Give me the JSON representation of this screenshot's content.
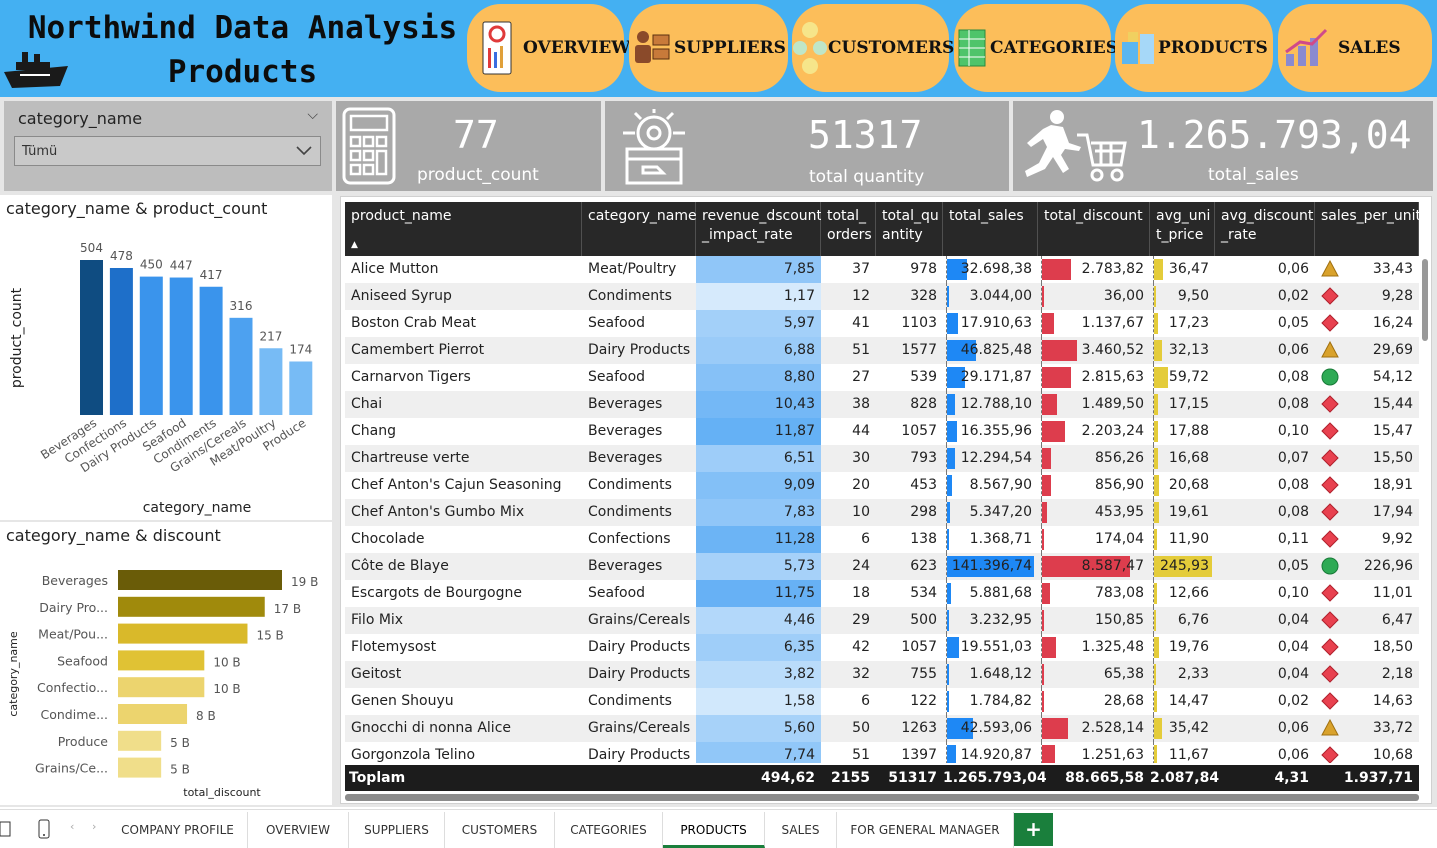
{
  "header": {
    "title_line1": "Northwind Data Analysis",
    "title_line2": "Products"
  },
  "nav": [
    {
      "label": "OVERVIEW",
      "icon": "overview-icon"
    },
    {
      "label": "SUPPLIERS",
      "icon": "suppliers-icon"
    },
    {
      "label": "CUSTOMERS",
      "icon": "customers-icon"
    },
    {
      "label": "CATEGORIES",
      "icon": "categories-icon"
    },
    {
      "label": "PRODUCTS",
      "icon": "products-icon"
    },
    {
      "label": "SALES",
      "icon": "sales-icon"
    }
  ],
  "slicer": {
    "title": "category_name",
    "value": "Tümü"
  },
  "kpis": [
    {
      "value": "77",
      "label": "product_count",
      "icon": "calculator-icon"
    },
    {
      "value": "51317",
      "label": "total quantity",
      "icon": "package-gear-icon"
    },
    {
      "value": "1.265.793,04",
      "label": "total_sales",
      "icon": "shopping-cart-runner-icon"
    }
  ],
  "colors": {
    "header_bg": "#44b0f2",
    "nav_bg": "#fcbe5a",
    "kpi_bg": "#a9a9a9",
    "bar_blue": "#1e88f5",
    "bar_red": "#dd3d4d",
    "bar_yellow": "#e4cc3a",
    "status_red": "#e8414f",
    "status_orange": "#d9a22c",
    "status_green": "#2eaa55"
  },
  "chart1": {
    "title": "category_name & product_count",
    "chart_data": {
      "type": "bar",
      "categories": [
        "Beverages",
        "Confections",
        "Dairy Products",
        "Seafood",
        "Condiments",
        "Grains/Cereals",
        "Meat/Poultry",
        "Produce"
      ],
      "values": [
        504,
        478,
        450,
        447,
        417,
        316,
        217,
        174
      ],
      "xlabel": "category_name",
      "ylabel": "product_count",
      "ylim": [
        0,
        560
      ],
      "colors": [
        "#0f4c81",
        "#1e6fc9",
        "#3a94ec",
        "#3a94ec",
        "#3a94ec",
        "#4da1f0",
        "#77bbf5",
        "#77bbf5"
      ]
    }
  },
  "chart2": {
    "title": "category_name & discount",
    "chart_data": {
      "type": "bar",
      "orientation": "horizontal",
      "categories": [
        "Beverages",
        "Dairy Pro...",
        "Meat/Pou...",
        "Seafood",
        "Confectio...",
        "Condime...",
        "Produce",
        "Grains/Ce..."
      ],
      "values": [
        19,
        17,
        15,
        10,
        10,
        8,
        5,
        5
      ],
      "value_labels": [
        "19 B",
        "17 B",
        "15 B",
        "10 B",
        "10 B",
        "8 B",
        "5 B",
        "5 B"
      ],
      "xlabel": "total_discount",
      "ylabel": "category_name",
      "xlim": [
        0,
        20
      ],
      "colors": [
        "#6a5c08",
        "#a08a0c",
        "#d9b92a",
        "#e0c234",
        "#ecd46e",
        "#ecd46e",
        "#f0de8a",
        "#f0de8a"
      ]
    }
  },
  "table": {
    "columns": [
      "product_name",
      "category_name",
      "revenue_dscount\n_impact_rate",
      "total_\norders",
      "total_qu\nantity",
      "total_sales",
      "total_discount",
      "avg_uni\nt_price",
      "avg_discount\n_rate",
      "sales_per_unit"
    ],
    "sort_indicator": "▲",
    "max": {
      "rev": 12,
      "sales": 141396.74,
      "disc": 8587.47,
      "price": 245.93
    },
    "rows": [
      {
        "name": "Alice Mutton",
        "cat": "Meat/Poultry",
        "rev": "7,85",
        "ord": "37",
        "qty": "978",
        "sales": "32.698,38",
        "disc": "2.783,82",
        "price": "36,47",
        "rate": "0,06",
        "status": "orange",
        "spu": "33,43"
      },
      {
        "name": "Aniseed Syrup",
        "cat": "Condiments",
        "rev": "1,17",
        "ord": "12",
        "qty": "328",
        "sales": "3.044,00",
        "disc": "36,00",
        "price": "9,50",
        "rate": "0,02",
        "status": "red",
        "spu": "9,28"
      },
      {
        "name": "Boston Crab Meat",
        "cat": "Seafood",
        "rev": "5,97",
        "ord": "41",
        "qty": "1103",
        "sales": "17.910,63",
        "disc": "1.137,67",
        "price": "17,23",
        "rate": "0,05",
        "status": "red",
        "spu": "16,24"
      },
      {
        "name": "Camembert Pierrot",
        "cat": "Dairy Products",
        "rev": "6,88",
        "ord": "51",
        "qty": "1577",
        "sales": "46.825,48",
        "disc": "3.460,52",
        "price": "32,13",
        "rate": "0,06",
        "status": "orange",
        "spu": "29,69"
      },
      {
        "name": "Carnarvon Tigers",
        "cat": "Seafood",
        "rev": "8,80",
        "ord": "27",
        "qty": "539",
        "sales": "29.171,87",
        "disc": "2.815,63",
        "price": "59,72",
        "rate": "0,08",
        "status": "green",
        "spu": "54,12"
      },
      {
        "name": "Chai",
        "cat": "Beverages",
        "rev": "10,43",
        "ord": "38",
        "qty": "828",
        "sales": "12.788,10",
        "disc": "1.489,50",
        "price": "17,15",
        "rate": "0,08",
        "status": "red",
        "spu": "15,44"
      },
      {
        "name": "Chang",
        "cat": "Beverages",
        "rev": "11,87",
        "ord": "44",
        "qty": "1057",
        "sales": "16.355,96",
        "disc": "2.203,24",
        "price": "17,88",
        "rate": "0,10",
        "status": "red",
        "spu": "15,47"
      },
      {
        "name": "Chartreuse verte",
        "cat": "Beverages",
        "rev": "6,51",
        "ord": "30",
        "qty": "793",
        "sales": "12.294,54",
        "disc": "856,26",
        "price": "16,68",
        "rate": "0,07",
        "status": "red",
        "spu": "15,50"
      },
      {
        "name": "Chef Anton's Cajun Seasoning",
        "cat": "Condiments",
        "rev": "9,09",
        "ord": "20",
        "qty": "453",
        "sales": "8.567,90",
        "disc": "856,90",
        "price": "20,68",
        "rate": "0,08",
        "status": "red",
        "spu": "18,91"
      },
      {
        "name": "Chef Anton's Gumbo Mix",
        "cat": "Condiments",
        "rev": "7,83",
        "ord": "10",
        "qty": "298",
        "sales": "5.347,20",
        "disc": "453,95",
        "price": "19,61",
        "rate": "0,08",
        "status": "red",
        "spu": "17,94"
      },
      {
        "name": "Chocolade",
        "cat": "Confections",
        "rev": "11,28",
        "ord": "6",
        "qty": "138",
        "sales": "1.368,71",
        "disc": "174,04",
        "price": "11,90",
        "rate": "0,11",
        "status": "red",
        "spu": "9,92"
      },
      {
        "name": "Côte de Blaye",
        "cat": "Beverages",
        "rev": "5,73",
        "ord": "24",
        "qty": "623",
        "sales": "141.396,74",
        "disc": "8.587,47",
        "price": "245,93",
        "rate": "0,05",
        "status": "green",
        "spu": "226,96"
      },
      {
        "name": "Escargots de Bourgogne",
        "cat": "Seafood",
        "rev": "11,75",
        "ord": "18",
        "qty": "534",
        "sales": "5.881,68",
        "disc": "783,08",
        "price": "12,66",
        "rate": "0,10",
        "status": "red",
        "spu": "11,01"
      },
      {
        "name": "Filo Mix",
        "cat": "Grains/Cereals",
        "rev": "4,46",
        "ord": "29",
        "qty": "500",
        "sales": "3.232,95",
        "disc": "150,85",
        "price": "6,76",
        "rate": "0,04",
        "status": "red",
        "spu": "6,47"
      },
      {
        "name": "Flotemysost",
        "cat": "Dairy Products",
        "rev": "6,35",
        "ord": "42",
        "qty": "1057",
        "sales": "19.551,03",
        "disc": "1.325,48",
        "price": "19,76",
        "rate": "0,04",
        "status": "red",
        "spu": "18,50"
      },
      {
        "name": "Geitost",
        "cat": "Dairy Products",
        "rev": "3,82",
        "ord": "32",
        "qty": "755",
        "sales": "1.648,12",
        "disc": "65,38",
        "price": "2,33",
        "rate": "0,04",
        "status": "red",
        "spu": "2,18"
      },
      {
        "name": "Genen Shouyu",
        "cat": "Condiments",
        "rev": "1,58",
        "ord": "6",
        "qty": "122",
        "sales": "1.784,82",
        "disc": "28,68",
        "price": "14,47",
        "rate": "0,02",
        "status": "red",
        "spu": "14,63"
      },
      {
        "name": "Gnocchi di nonna Alice",
        "cat": "Grains/Cereals",
        "rev": "5,60",
        "ord": "50",
        "qty": "1263",
        "sales": "42.593,06",
        "disc": "2.528,14",
        "price": "35,42",
        "rate": "0,06",
        "status": "orange",
        "spu": "33,72"
      },
      {
        "name": "Gorgonzola Telino",
        "cat": "Dairy Products",
        "rev": "7,74",
        "ord": "51",
        "qty": "1397",
        "sales": "14.920,87",
        "disc": "1.251,63",
        "price": "11,67",
        "rate": "0,06",
        "status": "red",
        "spu": "10,68"
      }
    ],
    "total": {
      "label": "Toplam",
      "rev": "494,62",
      "ord": "2155",
      "qty": "51317",
      "sales": "1.265.793,04",
      "disc": "88.665,58",
      "price": "2.087,84",
      "rate": "4,31",
      "spu": "1.937,71"
    }
  },
  "tabs": [
    "COMPANY PROFILE",
    "OVERVIEW",
    "SUPPLIERS",
    "CUSTOMERS",
    "CATEGORIES",
    "PRODUCTS",
    "SALES",
    "FOR GENERAL MANAGER"
  ],
  "active_tab": "PRODUCTS",
  "add_tab": "+"
}
